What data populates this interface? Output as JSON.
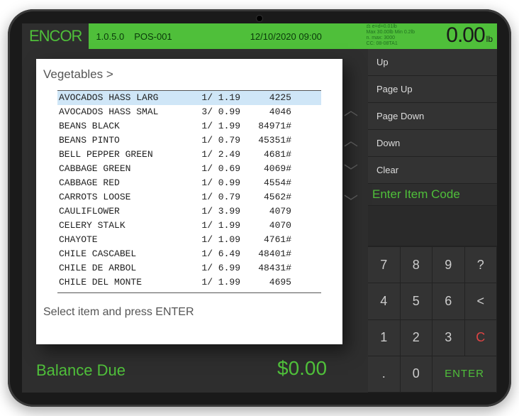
{
  "brand": "ENCOR",
  "header": {
    "version": "1.0.5.0",
    "terminal": "POS-001",
    "datetime": "12/10/2020 09:00",
    "status_lines": [
      "⚖ e=d=0.01lb",
      "Max 30.00lb Min 0.2lb",
      "n. max: 3000",
      "CC: 08-08TA1"
    ],
    "weight_value": "0.00",
    "weight_unit": "lb"
  },
  "panel": {
    "breadcrumb": "Vegetables >",
    "prompt": "Select item and press ENTER",
    "items": [
      {
        "name": "AVOCADOS HASS LARG",
        "price": "1/ 1.19",
        "code": "4225",
        "selected": true
      },
      {
        "name": "AVOCADOS HASS SMAL",
        "price": "3/ 0.99",
        "code": "4046"
      },
      {
        "name": "BEANS BLACK",
        "price": "1/ 1.99",
        "code": "84971#"
      },
      {
        "name": "BEANS PINTO",
        "price": "1/ 0.79",
        "code": "45351#"
      },
      {
        "name": "BELL PEPPER GREEN",
        "price": "1/ 2.49",
        "code": "4681#"
      },
      {
        "name": "CABBAGE GREEN",
        "price": "1/ 0.69",
        "code": "4069#"
      },
      {
        "name": "CABBAGE RED",
        "price": "1/ 0.99",
        "code": "4554#"
      },
      {
        "name": "CARROTS LOOSE",
        "price": "1/ 0.79",
        "code": "4562#"
      },
      {
        "name": "CAULIFLOWER",
        "price": "1/ 3.99",
        "code": "4079"
      },
      {
        "name": "CELERY STALK",
        "price": "1/ 1.99",
        "code": "4070"
      },
      {
        "name": "CHAYOTE",
        "price": "1/ 1.09",
        "code": "4761#"
      },
      {
        "name": "CHILE CASCABEL",
        "price": "1/ 6.49",
        "code": "48401#"
      },
      {
        "name": "CHILE DE ARBOL",
        "price": "1/ 6.99",
        "code": "48431#"
      },
      {
        "name": "CHILE DEL MONTE",
        "price": "1/ 1.99",
        "code": "4695"
      }
    ]
  },
  "nav_buttons": [
    "Up",
    "Page Up",
    "Page Down",
    "Down",
    "Clear"
  ],
  "item_code_label": "Enter Item Code",
  "keypad": [
    [
      "7",
      "8",
      "9",
      "?"
    ],
    [
      "4",
      "5",
      "6",
      "<"
    ],
    [
      "1",
      "2",
      "3",
      "C"
    ],
    [
      ".",
      "0",
      "ENTER"
    ]
  ],
  "balance": {
    "label": "Balance Due",
    "amount": "$0.00"
  }
}
